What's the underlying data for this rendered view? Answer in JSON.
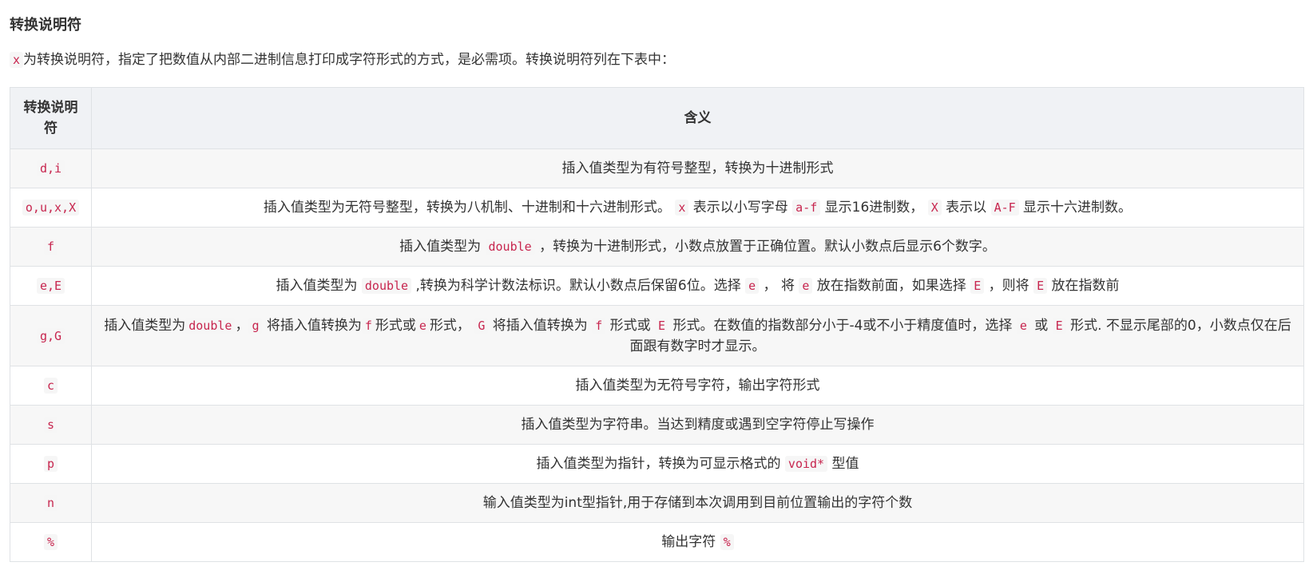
{
  "section": {
    "heading": "转换说明符",
    "intro_code": "x",
    "intro_text": "为转换说明符，指定了把数值从内部二进制信息打印成字符形式的方式，是必需项。转换说明符列在下表中："
  },
  "table": {
    "headers": {
      "spec": "转换说明符",
      "meaning": "含义"
    },
    "rows": [
      {
        "spec": "d,i",
        "meaning": [
          {
            "t": "插入值类型为有符号整型，转换为十进制形式"
          }
        ]
      },
      {
        "spec": "o,u,x,X",
        "meaning": [
          {
            "t": "插入值类型为无符号整型，转换为八机制、十进制和十六进制形式。 "
          },
          {
            "c": "x"
          },
          {
            "t": " 表示以小写字母 "
          },
          {
            "c": "a-f"
          },
          {
            "t": " 显示16进制数， "
          },
          {
            "c": "X"
          },
          {
            "t": " 表示以 "
          },
          {
            "c": "A-F"
          },
          {
            "t": " 显示十六进制数。"
          }
        ]
      },
      {
        "spec": "f",
        "meaning": [
          {
            "t": "插入值类型为 "
          },
          {
            "c": "double"
          },
          {
            "t": " ，转换为十进制形式，小数点放置于正确位置。默认小数点后显示6个数字。"
          }
        ]
      },
      {
        "spec": "e,E",
        "meaning": [
          {
            "t": "插入值类型为 "
          },
          {
            "c": "double"
          },
          {
            "t": " ,转换为科学计数法标识。默认小数点后保留6位。选择 "
          },
          {
            "c": "e"
          },
          {
            "t": " ， 将 "
          },
          {
            "c": "e"
          },
          {
            "t": " 放在指数前面，如果选择 "
          },
          {
            "c": "E"
          },
          {
            "t": " ，则将 "
          },
          {
            "c": "E"
          },
          {
            "t": " 放在指数前"
          }
        ]
      },
      {
        "spec": "g,G",
        "meaning": [
          {
            "t": "插入值类型为"
          },
          {
            "c": "double"
          },
          {
            "t": "，"
          },
          {
            "c": "g"
          },
          {
            "t": " 将插入值转换为"
          },
          {
            "c": "f"
          },
          {
            "t": "形式或"
          },
          {
            "c": "e"
          },
          {
            "t": "形式， "
          },
          {
            "c": "G"
          },
          {
            "t": " 将插入值转换为 "
          },
          {
            "c": "f"
          },
          {
            "t": " 形式或 "
          },
          {
            "c": "E"
          },
          {
            "t": " 形式。在数值的指数部分小于-4或不小于精度值时，选择 "
          },
          {
            "c": "e"
          },
          {
            "t": " 或 "
          },
          {
            "c": "E"
          },
          {
            "t": " 形式. 不显示尾部的0，小数点仅在后面跟有数字时才显示。"
          }
        ]
      },
      {
        "spec": "c",
        "meaning": [
          {
            "t": "插入值类型为无符号字符，输出字符形式"
          }
        ]
      },
      {
        "spec": "s",
        "meaning": [
          {
            "t": "插入值类型为字符串。当达到精度或遇到空字符停止写操作"
          }
        ]
      },
      {
        "spec": "p",
        "meaning": [
          {
            "t": "插入值类型为指针，转换为可显示格式的 "
          },
          {
            "c": "void*"
          },
          {
            "t": " 型值"
          }
        ]
      },
      {
        "spec": "n",
        "meaning": [
          {
            "t": "输入值类型为int型指针,用于存储到本次调用到目前位置输出的字符个数"
          }
        ]
      },
      {
        "spec": "%",
        "meaning": [
          {
            "t": "输出字符 "
          },
          {
            "c": "%"
          }
        ]
      }
    ]
  },
  "colors": {
    "code_text": "#c7254e",
    "code_bg": "#f6f6f6",
    "header_bg": "#f0f2f5",
    "border": "#dfe2e5",
    "stripe_bg": "#f7f7f7"
  }
}
